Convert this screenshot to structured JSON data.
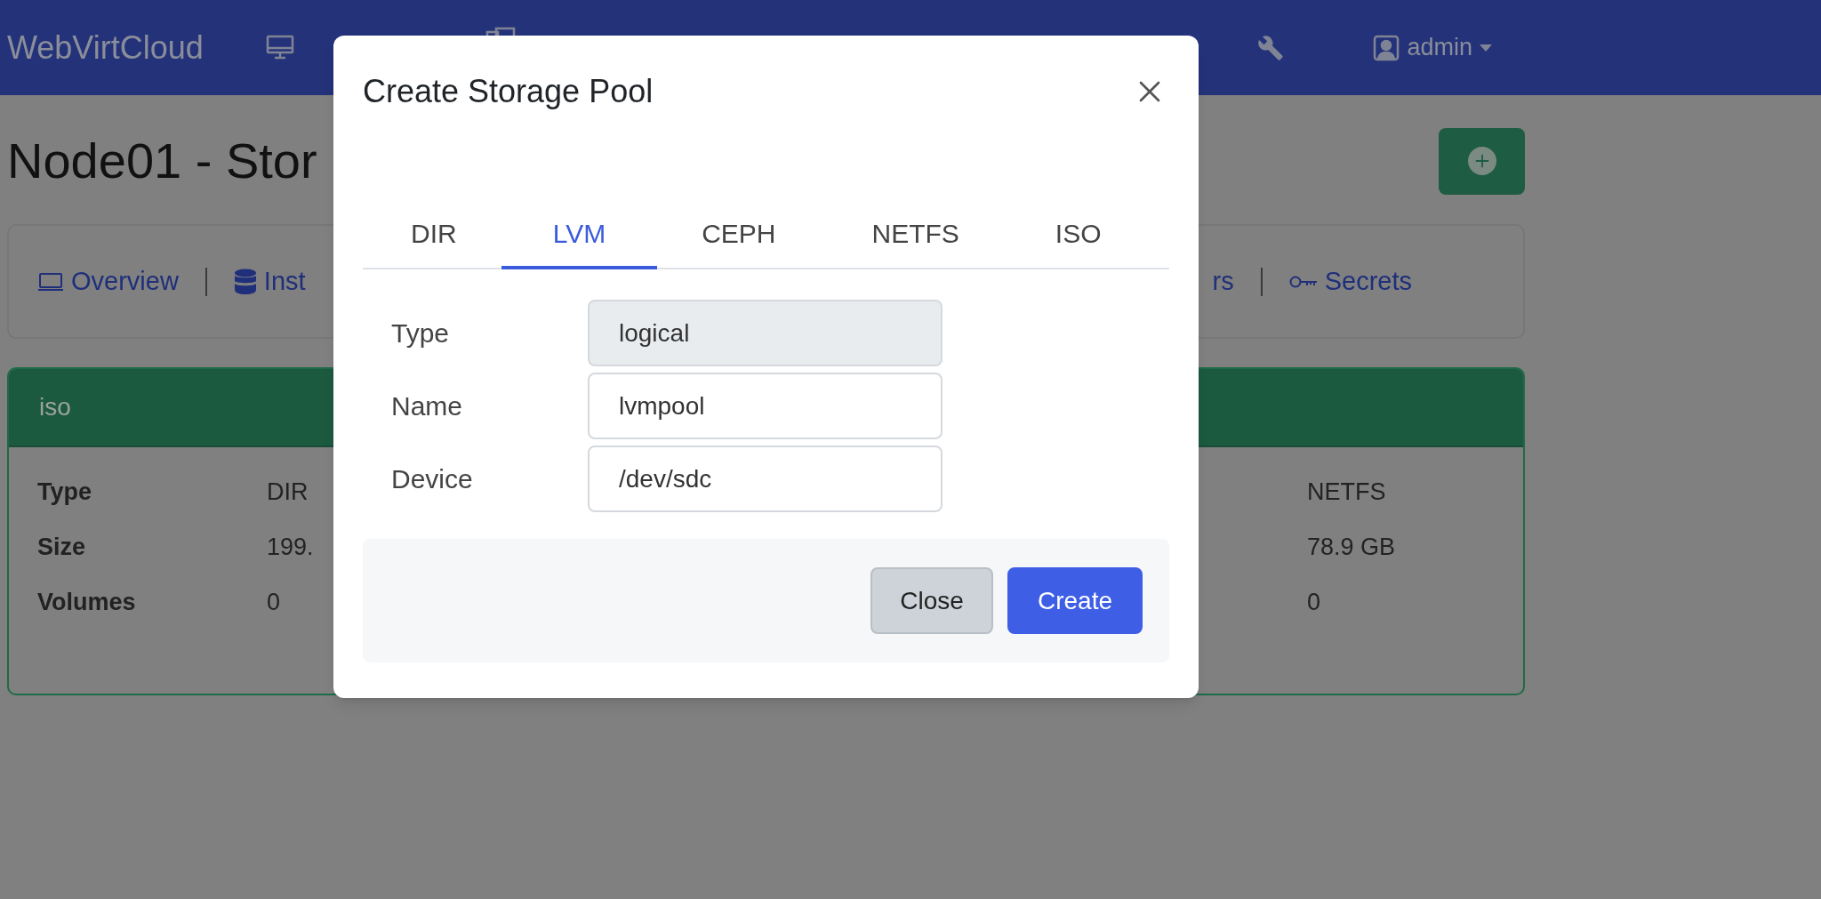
{
  "navbar": {
    "brand": "WebVirtCloud",
    "user": "admin"
  },
  "page": {
    "title": "Node01 - Stor"
  },
  "nav_links": [
    {
      "label": "Overview",
      "kind": "laptop"
    },
    {
      "label": "Inst",
      "kind": "database"
    }
  ],
  "nav_links_right": [
    {
      "label": "rs",
      "kind": "none"
    },
    {
      "label": "Secrets",
      "kind": "key"
    }
  ],
  "pool_card": {
    "title": "iso",
    "rows": [
      {
        "label": "Type",
        "value": "DIR",
        "value_2": "NETFS"
      },
      {
        "label": "Size",
        "value": "199.",
        "value_2": "78.9 GB"
      },
      {
        "label": "Volumes",
        "value": "0",
        "value_2": "0"
      }
    ]
  },
  "modal": {
    "title": "Create Storage Pool",
    "tabs": [
      {
        "label": "DIR",
        "selected": false
      },
      {
        "label": "LVM",
        "selected": true
      },
      {
        "label": "CEPH",
        "selected": false
      },
      {
        "label": "NETFS",
        "selected": false
      },
      {
        "label": "ISO",
        "selected": false
      }
    ],
    "fields": [
      {
        "label": "Type",
        "value": "logical",
        "disabled": true
      },
      {
        "label": "Name",
        "value": "lvmpool",
        "disabled": false
      },
      {
        "label": "Device",
        "value": "/dev/sdc",
        "disabled": false
      }
    ],
    "buttons": [
      {
        "label": "Close",
        "kind": "secondary"
      },
      {
        "label": "Create",
        "kind": "primary"
      }
    ]
  }
}
